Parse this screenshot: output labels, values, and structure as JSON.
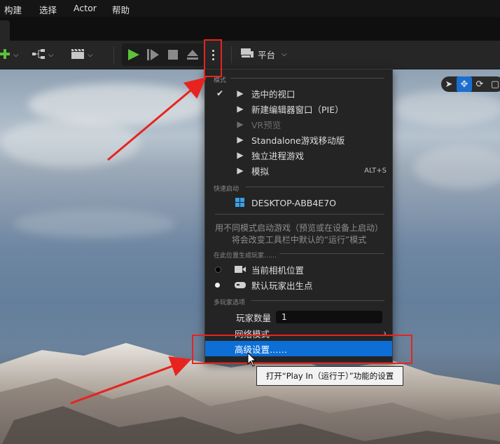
{
  "menubar": {
    "items": [
      "构建",
      "选择",
      "Actor",
      "帮助"
    ]
  },
  "toolbar": {
    "platform_label": "平台",
    "icons": [
      "add-actor-icon",
      "blueprint-icon",
      "cinematics-icon",
      "play-icon",
      "skip-frame-icon",
      "stop-icon",
      "eject-icon",
      "more-options-icon",
      "platform-icon"
    ]
  },
  "menu": {
    "section_modes": "模式",
    "modes": [
      {
        "label": "选中的视口",
        "checked": true,
        "icon": "viewport-play-icon"
      },
      {
        "label": "新建编辑器窗口（PIE）",
        "checked": false,
        "icon": "new-window-play-icon"
      },
      {
        "label": "VR预览",
        "checked": false,
        "disabled": true,
        "icon": "vr-play-icon"
      },
      {
        "label": "Standalone游戏移动版",
        "checked": false,
        "icon": "mobile-play-icon"
      },
      {
        "label": "独立进程游戏",
        "checked": false,
        "icon": "standalone-play-icon"
      },
      {
        "label": "模拟",
        "checked": false,
        "icon": "simulate-icon",
        "shortcut": "ALT+S"
      }
    ],
    "section_quick_launch": "快速启动",
    "quick_launch_device": "DESKTOP-ABB4E7O",
    "hint_text": "用不同模式启动游戏（预览或在设备上启动）将会改变工具栏中默认的“运行”模式",
    "section_spawn": "在此位置生成玩家……",
    "spawn_options": [
      {
        "label": "当前相机位置",
        "selected": false,
        "icon": "camera-icon"
      },
      {
        "label": "默认玩家出生点",
        "selected": true,
        "icon": "gamepad-icon"
      }
    ],
    "section_multiplayer": "多玩家选项",
    "players_label": "玩家数量",
    "players_value": "1",
    "net_mode_label": "网络模式",
    "advanced_label": "高级设置……"
  },
  "tooltip": {
    "text": "打开“Play In（运行于）”功能的设置"
  },
  "colors": {
    "accent": "#0d6fd6",
    "annotation_red": "#e8231f",
    "play_green": "#5cc13b"
  }
}
